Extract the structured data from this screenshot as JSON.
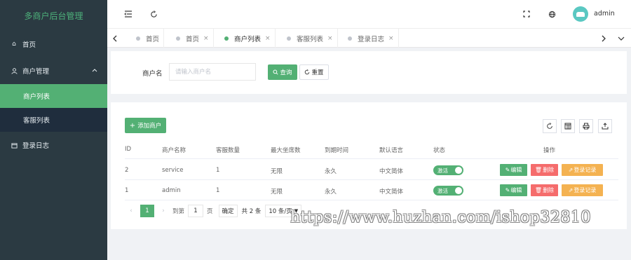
{
  "sidebar": {
    "brand": "多商户后台管理",
    "home": "首页",
    "merchant_mgmt": "商户管理",
    "sub_items": [
      "商户列表",
      "客服列表"
    ],
    "login_log": "登录日志"
  },
  "topbar": {
    "username": "admin"
  },
  "tabs": [
    {
      "label": "首页",
      "closable": false,
      "active": false
    },
    {
      "label": "首页",
      "closable": true,
      "active": false
    },
    {
      "label": "商户列表",
      "closable": true,
      "active": true
    },
    {
      "label": "客服列表",
      "closable": true,
      "active": false
    },
    {
      "label": "登录日志",
      "closable": true,
      "active": false
    }
  ],
  "search": {
    "label": "商户名",
    "placeholder": "请输入商户名",
    "search_btn": "查询",
    "reset_btn": "重置"
  },
  "table": {
    "add_btn": "添加商户",
    "headers": [
      "ID",
      "商户名称",
      "客服数量",
      "最大坐席数",
      "到期时间",
      "默认语言",
      "状态",
      "操作"
    ],
    "rows": [
      {
        "id": "2",
        "name": "service",
        "cs_count": "1",
        "max_seats": "无限",
        "expire": "永久",
        "lang": "中文简体",
        "status": "激活"
      },
      {
        "id": "1",
        "name": "admin",
        "cs_count": "1",
        "max_seats": "无限",
        "expire": "永久",
        "lang": "中文简体",
        "status": "激活"
      }
    ],
    "ops": {
      "edit": "编辑",
      "delete": "删除",
      "login_log": "登录记录"
    }
  },
  "pager": {
    "current": "1",
    "goto_label": "到第",
    "goto_value": "1",
    "page_unit": "页",
    "confirm": "确定",
    "total": "共 2 条",
    "page_size": "10 条/页"
  },
  "watermark": "https://www.huzhan.com/ishop32810",
  "colors": {
    "sidebar_bg": "#2b3a42",
    "accent": "#53b074",
    "danger": "#f56c6c",
    "warning": "#f4b251"
  }
}
